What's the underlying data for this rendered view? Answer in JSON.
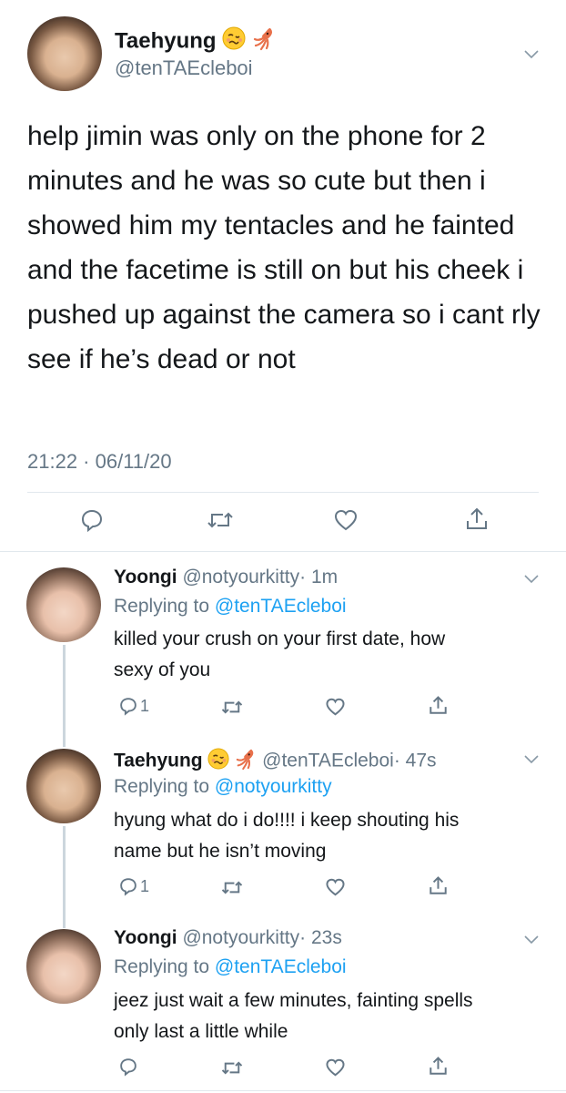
{
  "main_tweet": {
    "name": "Taehyung",
    "handle": "@tenTAEcleboi",
    "text": "help jimin was only on the phone for 2 minutes and he was so cute but then i showed him my tentacles and he fainted and the facetime is still on but his cheek i pushed up against the camera so i cant rly see if he’s dead or not",
    "timestamp": "21:22 · 06/11/20"
  },
  "replies": [
    {
      "name": "Yoongi",
      "handle": "@notyourkitty",
      "time": "· 1m",
      "replying_prefix": "Replying to ",
      "replying_to": "@tenTAEcleboi",
      "line1": "killed your crush on your first date, how",
      "line2": "sexy of you",
      "reply_count": "1"
    },
    {
      "name": "Taehyung",
      "handle": "@tenTAEcleboi",
      "time": "· 47s",
      "replying_prefix": "Replying to ",
      "replying_to": "@notyourkitty",
      "line1": "hyung what do i do!!!! i keep shouting his",
      "line2": "name but he isn’t moving",
      "reply_count": "1"
    },
    {
      "name": "Yoongi",
      "handle": "@notyourkitty",
      "time": "· 23s",
      "replying_prefix": "Replying to ",
      "replying_to": "@tenTAEcleboi",
      "line1": "jeez just wait a few minutes, fainting spells",
      "line2": "only last a little while"
    }
  ],
  "icons": [
    "reply-icon",
    "retweet-icon",
    "like-icon",
    "share-icon",
    "chevron-down-icon",
    "woozy-face-emoji",
    "squid-emoji"
  ],
  "colors": {
    "link": "#1da1f2",
    "secondary": "#657786",
    "text": "#14171a",
    "divider": "#e1e8ed"
  }
}
